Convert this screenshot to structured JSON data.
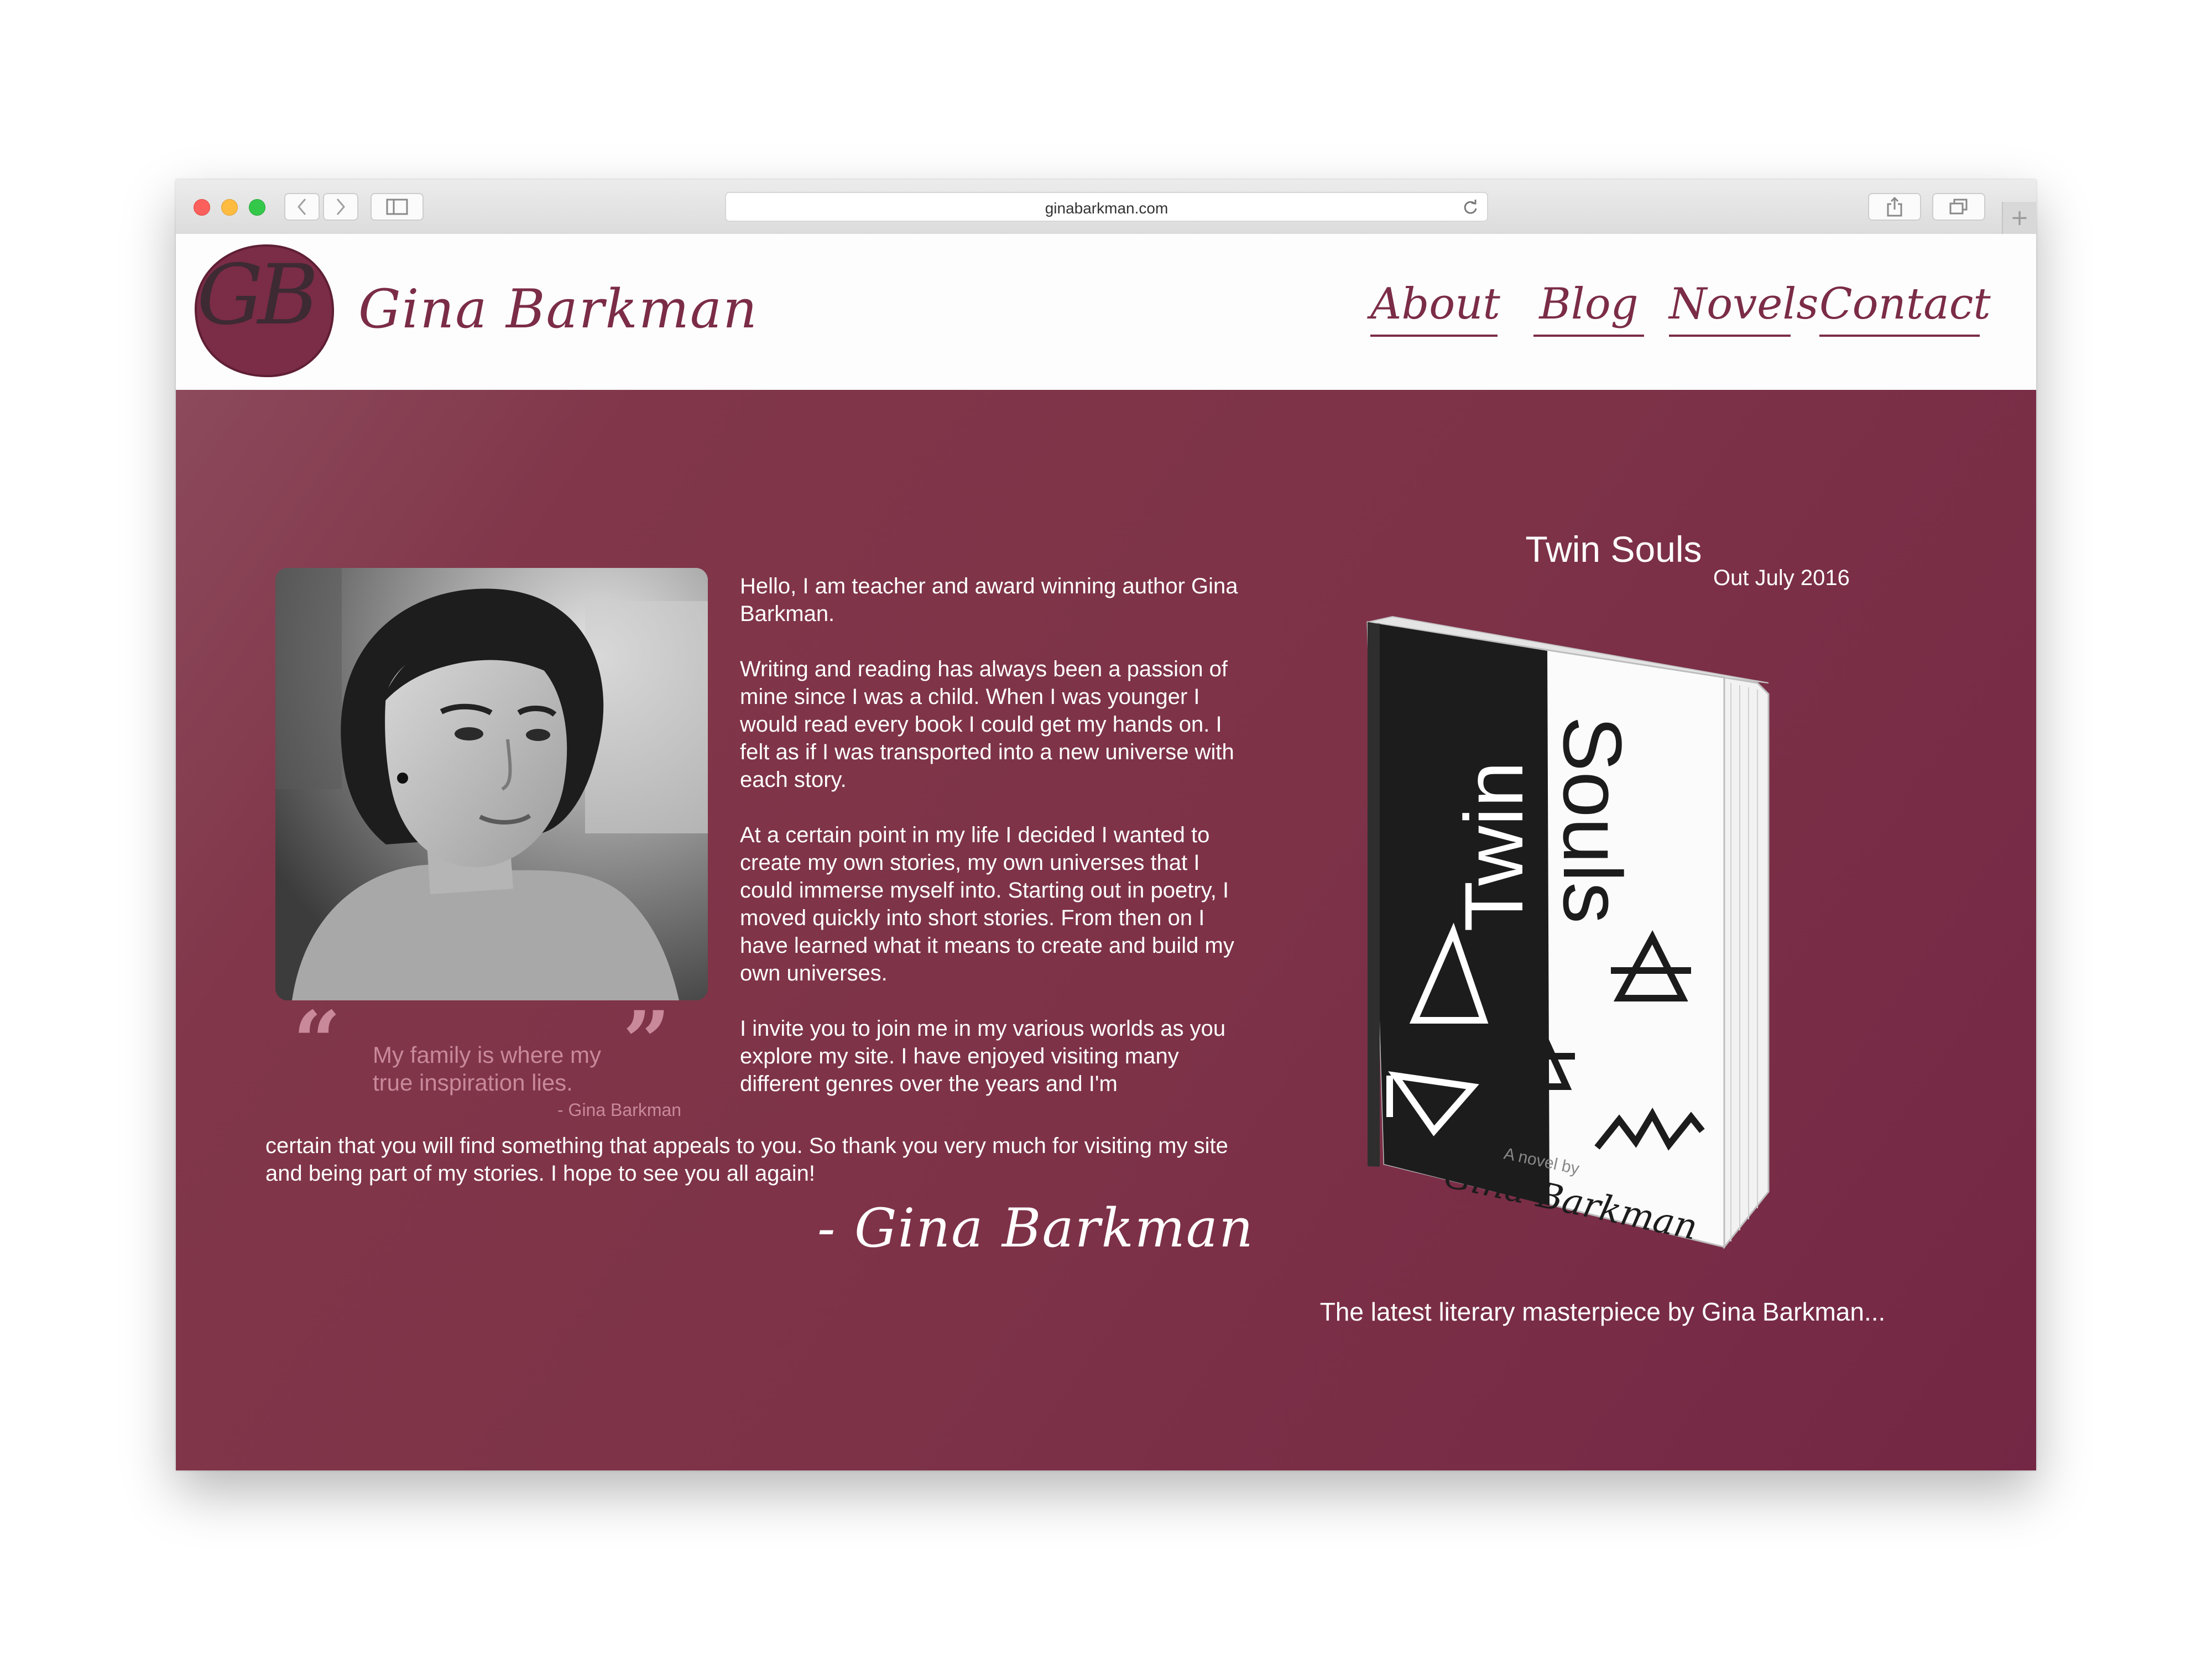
{
  "browser": {
    "url": "ginabarkman.com",
    "new_tab_label": "+"
  },
  "header": {
    "logo_monogram": "GB",
    "site_name": "Gina Barkman",
    "nav": [
      "About",
      "Blog",
      "Novels",
      "Contact"
    ]
  },
  "colors": {
    "brand": "#7b2c46",
    "hero_background": "#7d3248",
    "quote_accent": "#c9899b"
  },
  "intro": {
    "paragraphs": [
      "Hello, I am teacher and award winning author Gina Barkman.",
      "Writing and reading has always been a passion of mine since I was a child. When I was younger I would read every book I could get my hands on. I felt as if I was transported into a new universe with each story.",
      "At a certain point in my life I decided I wanted to create my own stories, my own universes that I could immerse myself into. Starting out in poetry, I moved quickly into short stories. From then on I have learned what it means to create and build my own universes.",
      "I invite you to join me in my various worlds as you explore my site. I have enjoyed visiting many different genres over the years and I'm"
    ],
    "closing": "certain that you will find something that appeals to you. So thank you very much for visiting my site and being part of my stories. I hope to see you all again!",
    "signature": "- Gina Barkman"
  },
  "quote": {
    "open_mark": "“",
    "close_mark": "”",
    "text": "My family is where my true inspiration lies.",
    "author": "- Gina Barkman"
  },
  "book": {
    "title": "Twin Souls",
    "release": "Out July 2016",
    "cover_word_1": "Twin",
    "cover_word_2": "Souls",
    "cover_byline": "A novel by",
    "cover_author": "Gina Barkman",
    "caption": "The latest literary masterpiece by Gina Barkman..."
  }
}
